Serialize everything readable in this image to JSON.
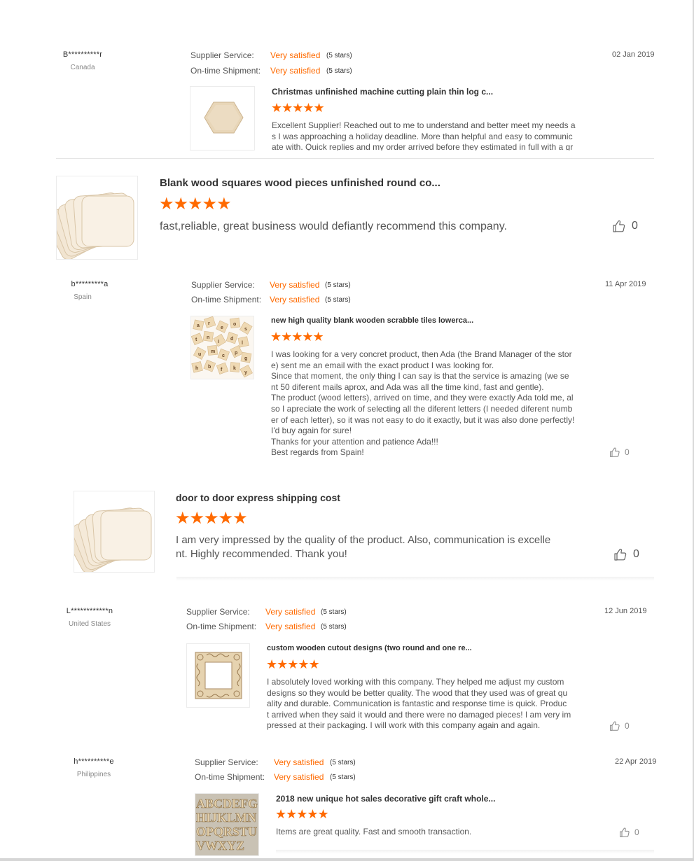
{
  "reviews": [
    {
      "buyer": "B**********r",
      "country": "Canada",
      "supplier_label": "Supplier Service:",
      "supplier_value": "Very satisfied",
      "supplier_stars": "(5 stars)",
      "shipment_label": "On-time Shipment:",
      "shipment_value": "Very satisfied",
      "shipment_stars": "(5 stars)",
      "date": "02 Jan 2019",
      "product": "Christmas unfinished machine cutting plain thin log c...",
      "rating_stars": "★★★★★",
      "text_lines": [
        "Excellent Supplier! Reached out to me to understand and better meet my needs a",
        "s I was approaching a holiday deadline. More than helpful and easy to communic",
        "ate with. Quick replies and my order arrived before they estimated in full with a gr"
      ]
    },
    {
      "buyer": "b*********a",
      "country": "Spain",
      "supplier_label": "Supplier Service:",
      "supplier_value": "Very satisfied",
      "supplier_stars": "(5 stars)",
      "shipment_label": "On-time Shipment:",
      "shipment_value": "Very satisfied",
      "shipment_stars": "(5 stars)",
      "date": "11 Apr 2019",
      "product": "new high quality blank wooden scrabble tiles lowerca...",
      "rating_stars": "★★★★★",
      "text_lines": [
        "I was looking for a very concret product, then Ada (the Brand Manager of the stor",
        "e) sent me an email with the exact product I was looking for.",
        "Since that moment, the only thing I can say is that the service is amazing (we se",
        "nt 50 diferent mails aprox, and Ada was all the time kind, fast and gentle).",
        "The product (wood letters), arrived on time, and they were exactly Ada told me, al",
        "so I apreciate the work of selecting all the diferent letters (I needed diferent numb",
        "er of each letter), so it was not easy to do it exactly, but it was also done perfectly!",
        "I'd buy again for sure!",
        "Thanks for your attention and patience Ada!!!",
        "Best regards from Spain!"
      ],
      "likes": "0"
    },
    {
      "buyer": "L************n",
      "country": "United States",
      "supplier_label": "Supplier Service:",
      "supplier_value": "Very satisfied",
      "supplier_stars": "(5 stars)",
      "shipment_label": "On-time Shipment:",
      "shipment_value": "Very satisfied",
      "shipment_stars": "(5 stars)",
      "date": "12 Jun 2019",
      "product": "custom wooden cutout designs (two round and one re...",
      "rating_stars": "★★★★★",
      "text_lines": [
        "I absolutely loved working with this company. They helped me adjust my custom",
        "designs so they would be better quality. The wood that they used was of great qu",
        "ality and durable. Communication is fantastic and response time is quick.  Produc",
        "t arrived when they said it would and there were no damaged pieces! I am very im",
        "pressed at their packaging. I will work with this company again and again."
      ],
      "likes": "0"
    },
    {
      "buyer": "h**********e",
      "country": "Philippines",
      "supplier_label": "Supplier Service:",
      "supplier_value": "Very satisfied",
      "supplier_stars": "(5 stars)",
      "shipment_label": "On-time Shipment:",
      "shipment_value": "Very satisfied",
      "shipment_stars": "(5 stars)",
      "date": "22 Apr 2019",
      "product": "2018 new unique hot sales decorative gift craft whole...",
      "rating_stars": "★★★★★",
      "text_lines": [
        "Items are great quality. Fast and smooth transaction."
      ],
      "likes": "0"
    }
  ],
  "zoomed": [
    {
      "product": "Blank wood squares wood pieces unfinished round co...",
      "rating_stars": "★★★★★",
      "text_lines": [
        "fast,reliable, great business would defiantly recommend this company."
      ],
      "likes": "0"
    },
    {
      "product": "door to door express shipping cost",
      "rating_stars": "★★★★★",
      "text_lines": [
        "I am very impressed by the quality of the product. Also, communication is excelle",
        "nt. Highly recommended. Thank you!"
      ],
      "likes": "0"
    }
  ],
  "colors": {
    "accent": "#ff6a00",
    "text": "#333333",
    "muted": "#888888"
  }
}
